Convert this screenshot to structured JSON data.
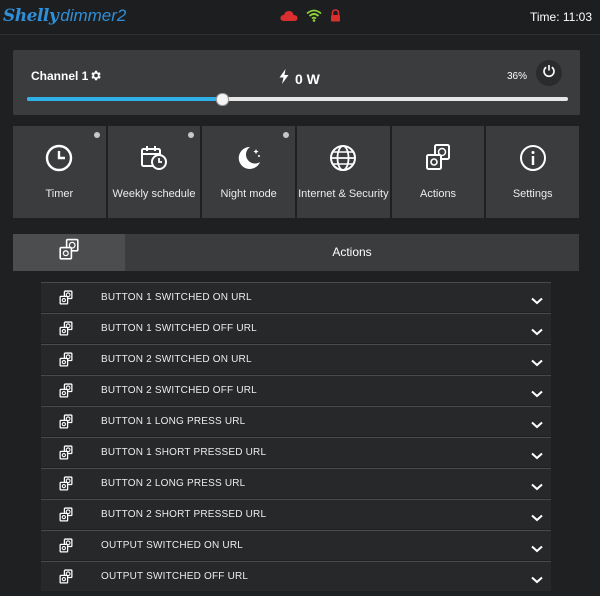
{
  "app": {
    "brand": "Shelly",
    "product": "dimmer2",
    "time": "Time: 11:03"
  },
  "status_icons": [
    "cloud-icon",
    "wifi-icon",
    "lock-icon"
  ],
  "colors": {
    "accent": "#2fb0e6",
    "cloud": "#d9302f",
    "wifi": "#8fd13a",
    "lock": "#d9302f"
  },
  "channel": {
    "title": "Channel 1",
    "power": "0 W",
    "brightness_label": "36%",
    "brightness_value": 36
  },
  "tiles": [
    {
      "label": "Timer",
      "icon": "clock-icon",
      "dot": true
    },
    {
      "label": "Weekly schedule",
      "icon": "calendar-icon",
      "dot": true
    },
    {
      "label": "Night mode",
      "icon": "moon-icon",
      "dot": true
    },
    {
      "label": "Internet & Security",
      "icon": "globe-icon",
      "dot": false
    },
    {
      "label": "Actions",
      "icon": "actions-icon",
      "dot": false
    },
    {
      "label": "Settings",
      "icon": "info-icon",
      "dot": false
    }
  ],
  "section": {
    "title": "Actions"
  },
  "actions": [
    "BUTTON 1 SWITCHED ON URL",
    "BUTTON 1 SWITCHED OFF URL",
    "BUTTON 2 SWITCHED ON URL",
    "BUTTON 2 SWITCHED OFF URL",
    "BUTTON 1 LONG PRESS URL",
    "BUTTON 1 SHORT PRESSED URL",
    "BUTTON 2 LONG PRESS URL",
    "BUTTON 2 SHORT PRESSED URL",
    "OUTPUT SWITCHED ON URL",
    "OUTPUT SWITCHED OFF URL"
  ]
}
